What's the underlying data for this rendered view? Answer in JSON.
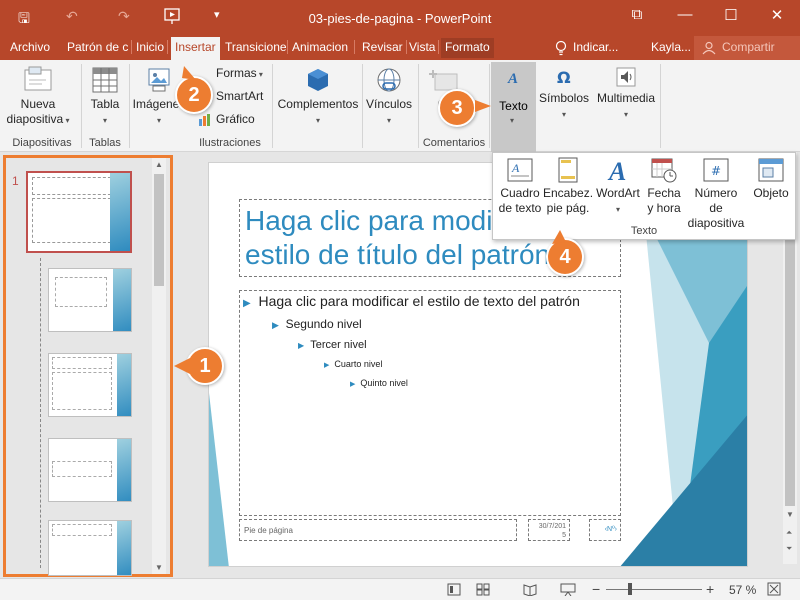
{
  "window": {
    "title": "03-pies-de-pagina - PowerPoint",
    "minimize": "—",
    "maximize": "☐",
    "close": "✕",
    "restore": "⧉"
  },
  "qat": {
    "save": "🖫",
    "undo": "↶",
    "redo": "↷",
    "customize": "▾"
  },
  "tabs": [
    "Archivo",
    "Patrón de c",
    "Inicio",
    "Insertar",
    "Transicione",
    "Animacion",
    "Revisar",
    "Vista",
    "Formato"
  ],
  "active_tab": "Insertar",
  "header_right": {
    "tell_me": "Indicar...",
    "user": "Kayla...",
    "share": "Compartir"
  },
  "ribbon": {
    "diapositivas": {
      "btn_line1": "Nueva",
      "btn_line2": "diapositiva",
      "group": "Diapositivas"
    },
    "tablas": {
      "btn": "Tabla",
      "group": "Tablas"
    },
    "ilustraciones": {
      "imagenes": "Imágenes",
      "formas": "Formas",
      "smartart": "SmartArt",
      "grafico": "Gráfico",
      "group": "Ilustraciones"
    },
    "complementos": {
      "btn": "Complementos"
    },
    "vinculos": {
      "btn": "Vínculos"
    },
    "comentarios": {
      "btn": "Co",
      "group": "Comentarios"
    },
    "texto": {
      "btn": "Texto"
    },
    "simbolos": {
      "btn": "Símbolos"
    },
    "multimedia": {
      "btn": "Multimedia"
    }
  },
  "texto_dropdown": {
    "items": [
      {
        "line1": "Cuadro",
        "line2": "de texto"
      },
      {
        "line1": "Encabez.",
        "line2": "pie pág."
      },
      {
        "line1": "WordArt",
        "line2": ""
      },
      {
        "line1": "Fecha",
        "line2": "y hora"
      },
      {
        "line1": "Número de",
        "line2": "diapositiva"
      },
      {
        "line1": "Objeto",
        "line2": ""
      }
    ],
    "group": "Texto"
  },
  "thumbnails": {
    "first_number": "1"
  },
  "slide": {
    "title_line1": "Haga clic para modif",
    "title_line2": "estilo de título del patrón",
    "levels": [
      "Haga clic para modificar el estilo de texto del patrón",
      "Segundo nivel",
      "Tercer nivel",
      "Cuarto nivel",
      "Quinto nivel"
    ],
    "footer": "Pie de página",
    "date_line1": "30/7/201",
    "date_line2": "5",
    "slide_number": "‹Nº›"
  },
  "status": {
    "zoom": "57 %",
    "minus": "−",
    "plus": "+"
  },
  "badges": [
    "1",
    "2",
    "3",
    "4"
  ],
  "colors": {
    "accent": "#b7472a",
    "badge": "#ed7d31",
    "title_blue": "#2e8bbf",
    "teal": "#3aa0b8"
  }
}
